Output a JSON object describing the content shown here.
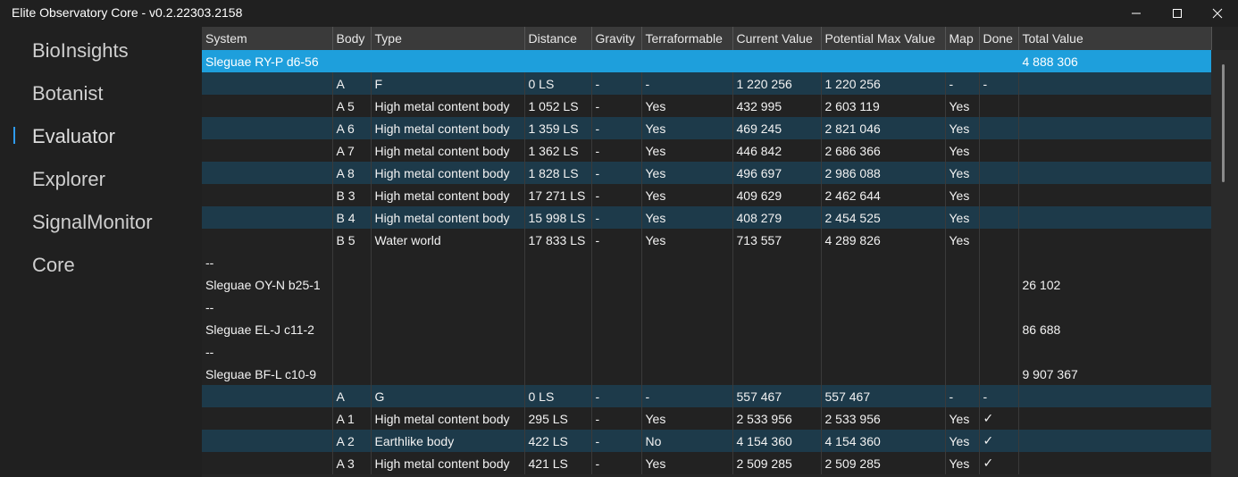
{
  "window": {
    "title": "Elite Observatory Core - v0.2.22303.2158",
    "minimize_icon": "minimize-icon",
    "maximize_icon": "maximize-icon",
    "close_icon": "close-icon"
  },
  "sidebar": {
    "items": [
      {
        "label": "BioInsights"
      },
      {
        "label": "Botanist"
      },
      {
        "label": "Evaluator",
        "active": true
      },
      {
        "label": "Explorer"
      },
      {
        "label": "SignalMonitor"
      },
      {
        "label": "Core"
      }
    ]
  },
  "table": {
    "columns": [
      "System",
      "Body",
      "Type",
      "Distance",
      "Gravity",
      "Terraformable",
      "Current Value",
      "Potential Max Value",
      "Map",
      "Done",
      "Total Value"
    ],
    "rows": [
      {
        "cells": [
          "Sleguae RY-P d6-56",
          "",
          "",
          "",
          "",
          "",
          "",
          "",
          "",
          "",
          "4 888 306"
        ],
        "selected": true
      },
      {
        "cells": [
          "",
          "A",
          "F",
          "0 LS",
          "-",
          "-",
          "1 220 256",
          "1 220 256",
          "-",
          "-",
          ""
        ]
      },
      {
        "cells": [
          "",
          "A 5",
          "High metal content body",
          "1 052 LS",
          "-",
          "Yes",
          "432 995",
          "2 603 119",
          "Yes",
          "",
          ""
        ]
      },
      {
        "cells": [
          "",
          "A 6",
          "High metal content body",
          "1 359 LS",
          "-",
          "Yes",
          "469 245",
          "2 821 046",
          "Yes",
          "",
          ""
        ]
      },
      {
        "cells": [
          "",
          "A 7",
          "High metal content body",
          "1 362 LS",
          "-",
          "Yes",
          "446 842",
          "2 686 366",
          "Yes",
          "",
          ""
        ]
      },
      {
        "cells": [
          "",
          "A 8",
          "High metal content body",
          "1 828 LS",
          "-",
          "Yes",
          "496 697",
          "2 986 088",
          "Yes",
          "",
          ""
        ]
      },
      {
        "cells": [
          "",
          "B 3",
          "High metal content body",
          "17 271 LS",
          "-",
          "Yes",
          "409 629",
          "2 462 644",
          "Yes",
          "",
          ""
        ]
      },
      {
        "cells": [
          "",
          "B 4",
          "High metal content body",
          "15 998 LS",
          "-",
          "Yes",
          "408 279",
          "2 454 525",
          "Yes",
          "",
          ""
        ]
      },
      {
        "cells": [
          "",
          "B 5",
          "Water world",
          "17 833 LS",
          "-",
          "Yes",
          "713 557",
          "4 289 826",
          "Yes",
          "",
          ""
        ]
      },
      {
        "cells": [
          "--",
          "",
          "",
          "",
          "",
          "",
          "",
          "",
          "",
          "",
          ""
        ],
        "separator": true
      },
      {
        "cells": [
          "Sleguae OY-N b25-1",
          "",
          "",
          "",
          "",
          "",
          "",
          "",
          "",
          "",
          "26 102"
        ]
      },
      {
        "cells": [
          "--",
          "",
          "",
          "",
          "",
          "",
          "",
          "",
          "",
          "",
          ""
        ],
        "separator": true
      },
      {
        "cells": [
          "Sleguae EL-J c11-2",
          "",
          "",
          "",
          "",
          "",
          "",
          "",
          "",
          "",
          "86 688"
        ]
      },
      {
        "cells": [
          "--",
          "",
          "",
          "",
          "",
          "",
          "",
          "",
          "",
          "",
          ""
        ],
        "separator": true
      },
      {
        "cells": [
          "Sleguae BF-L c10-9",
          "",
          "",
          "",
          "",
          "",
          "",
          "",
          "",
          "",
          "9 907 367"
        ]
      },
      {
        "cells": [
          "",
          "A",
          "G",
          "0 LS",
          "-",
          "-",
          "557 467",
          "557 467",
          "-",
          "-",
          ""
        ]
      },
      {
        "cells": [
          "",
          "A 1",
          "High metal content body",
          "295 LS",
          "-",
          "Yes",
          "2 533 956",
          "2 533 956",
          "Yes",
          "✓",
          ""
        ]
      },
      {
        "cells": [
          "",
          "A 2",
          "Earthlike body",
          "422 LS",
          "-",
          "No",
          "4 154 360",
          "4 154 360",
          "Yes",
          "✓",
          ""
        ]
      },
      {
        "cells": [
          "",
          "A 3",
          "High metal content body",
          "421 LS",
          "-",
          "Yes",
          "2 509 285",
          "2 509 285",
          "Yes",
          "✓",
          ""
        ]
      }
    ]
  }
}
